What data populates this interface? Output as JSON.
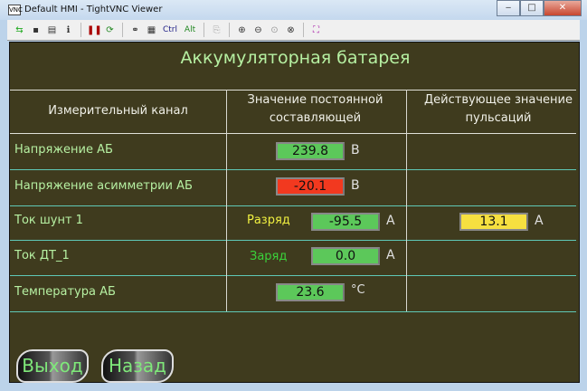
{
  "window": {
    "title": "Default HMI - TightVNC Viewer",
    "minimize": "‒",
    "maximize": "□",
    "close": "✕"
  },
  "toolbar": {
    "ctrl_label": "Ctrl",
    "alt_label": "Alt"
  },
  "screen": {
    "title": "Аккумуляторная батарея",
    "headers": [
      "Измерительный канал",
      "Значение постоянной составляющей",
      "Действующее значение пульсаций"
    ],
    "rows": [
      {
        "channel": "Напряжение АБ",
        "value": "239.8",
        "unit": "В",
        "color": "#5cc85a"
      },
      {
        "channel": "Напряжение асимметрии АБ",
        "value": "-20.1",
        "unit": "В",
        "color": "#f2391f"
      },
      {
        "channel": "Ток  шунт 1",
        "mode": "Разряд",
        "mode_color": "#f0f040",
        "value": "-95.5",
        "unit": "А",
        "color": "#5cc85a",
        "ripple": "13.1",
        "ripple_unit": "А",
        "ripple_color": "#f6e040"
      },
      {
        "channel": "Ток  ДТ_1",
        "mode": "Заряд",
        "mode_color": "#3ad23a",
        "value": "0.0",
        "unit": "А",
        "color": "#5cc85a"
      },
      {
        "channel": "Температура АБ",
        "value": "23.6",
        "unit": "°C",
        "color": "#5cc85a"
      }
    ],
    "buttons": {
      "exit": "Выход",
      "back": "Назад"
    }
  }
}
